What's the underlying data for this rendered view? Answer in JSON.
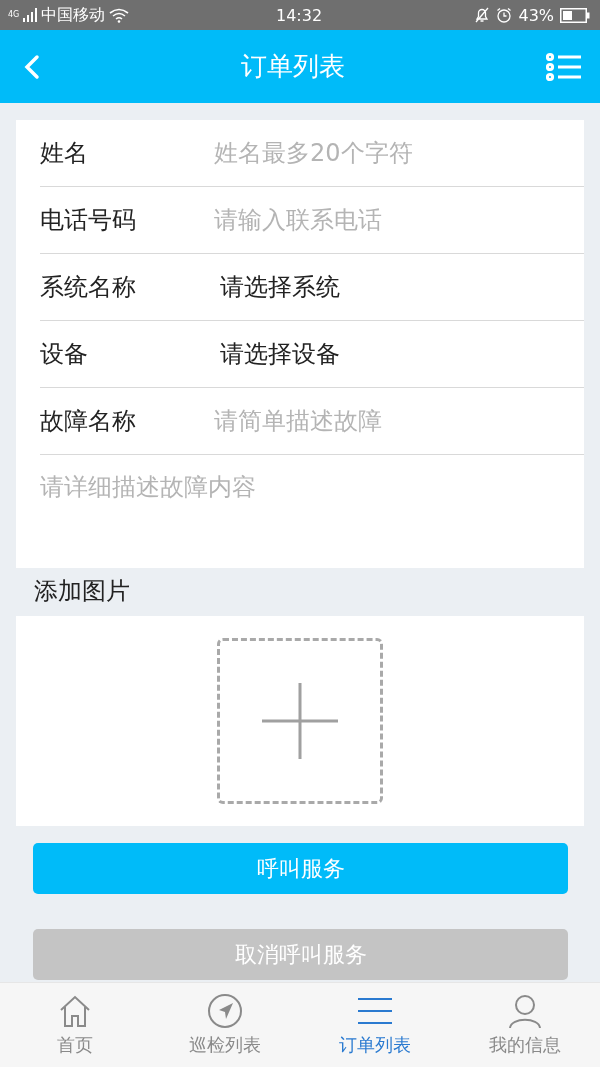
{
  "status_bar": {
    "carrier": "中国移动",
    "network": "4G",
    "time": "14:32",
    "battery": "43%"
  },
  "header": {
    "title": "订单列表"
  },
  "form": {
    "fields": [
      {
        "kind": "input",
        "label": "姓名",
        "placeholder": "姓名最多20个字符"
      },
      {
        "kind": "input",
        "label": "电话号码",
        "placeholder": "请输入联系电话"
      },
      {
        "kind": "select",
        "label": "系统名称",
        "value": "请选择系统"
      },
      {
        "kind": "select",
        "label": "设备",
        "value": "请选择设备"
      },
      {
        "kind": "input",
        "label": "故障名称",
        "placeholder": "请简单描述故障"
      }
    ],
    "description": {
      "placeholder": "请详细描述故障内容"
    }
  },
  "photos": {
    "title": "添加图片"
  },
  "buttons": [
    {
      "label": "呼叫服务",
      "disabled": false
    },
    {
      "label": "取消呼叫服务",
      "disabled": true
    }
  ],
  "tab_bar": [
    {
      "kind": "home",
      "label": "首页",
      "selected": false
    },
    {
      "kind": "compass",
      "label": "巡检列表",
      "selected": false
    },
    {
      "kind": "list",
      "label": "订单列表",
      "selected": true
    },
    {
      "kind": "user",
      "label": "我的信息",
      "selected": false
    }
  ]
}
